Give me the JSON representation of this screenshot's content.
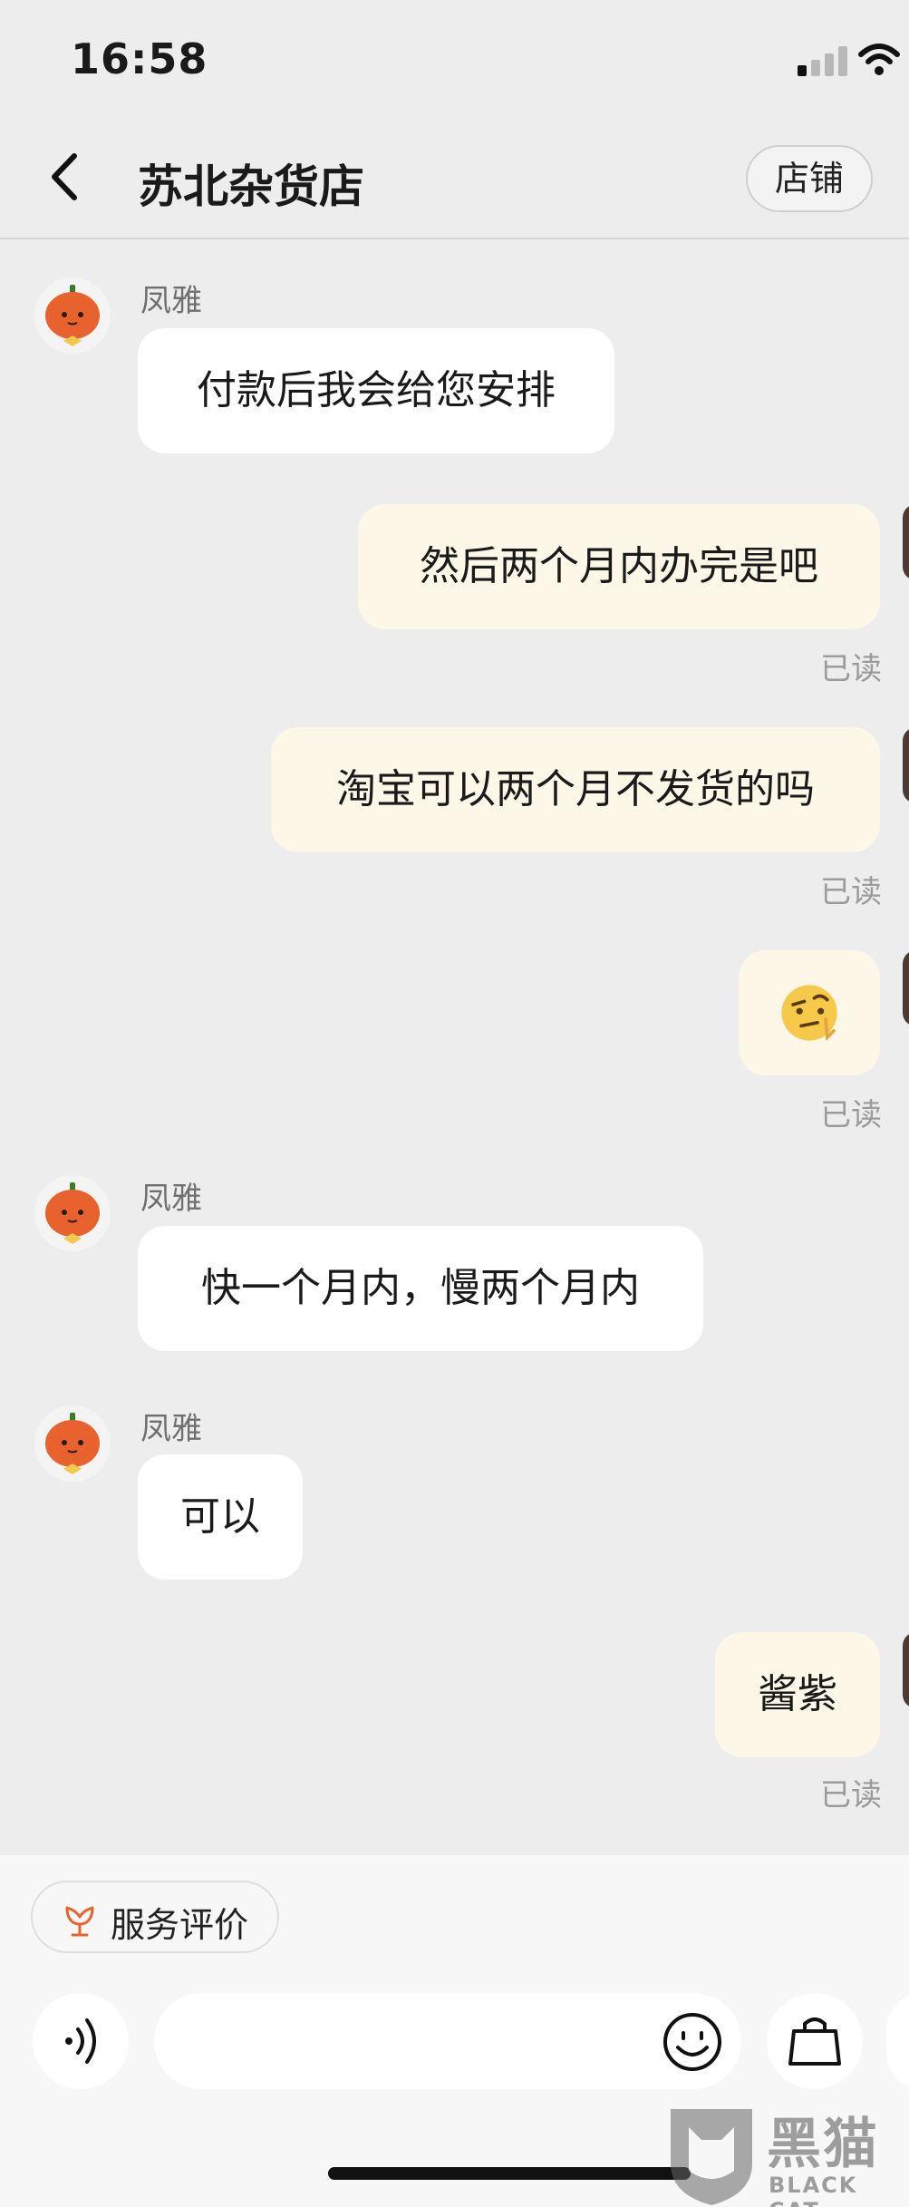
{
  "status_bar": {
    "time": "16:58"
  },
  "header": {
    "title": "苏北杂货店",
    "store_label": "店铺"
  },
  "messages": [
    {
      "sender": "凤雅",
      "text": "付款后我会给您安排"
    },
    {
      "text": "然后两个月内办完是吧",
      "read": "已读"
    },
    {
      "text": "淘宝可以两个月不发货的吗",
      "read": "已读"
    },
    {
      "emoji": "🤨",
      "read": "已读"
    },
    {
      "sender": "凤雅",
      "text": "快一个月内，慢两个月内"
    },
    {
      "sender": "凤雅",
      "text": "可以"
    },
    {
      "text": "酱紫",
      "read": "已读"
    }
  ],
  "bottom": {
    "review_label": "服务评价",
    "input_placeholder": ""
  },
  "watermark": {
    "title": "黑猫",
    "subtitle": "BLACK CAT"
  },
  "colors": {
    "background": "#ededed",
    "incoming_bubble": "#ffffff",
    "outgoing_bubble": "#fdf7e8",
    "accent": "#e8622e"
  },
  "icons": [
    "back-icon",
    "pumpkin-avatar-icon",
    "flower-icon",
    "voice-icon",
    "smile-icon",
    "shopping-bag-icon",
    "wifi-icon",
    "signal-icon"
  ]
}
